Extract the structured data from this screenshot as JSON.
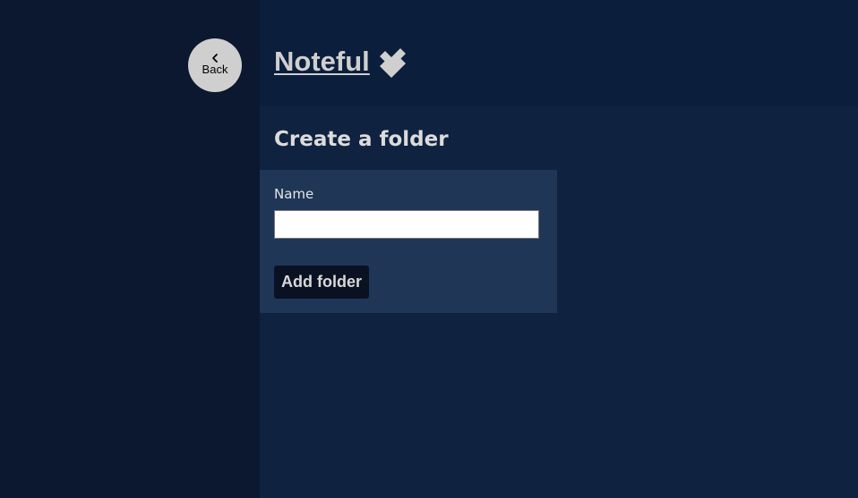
{
  "nav": {
    "back_label": "Back",
    "back_icon": "chevron-left-icon"
  },
  "header": {
    "title": "Noteful",
    "title_icon": "double-check-icon"
  },
  "main": {
    "page_title": "Create a folder",
    "form": {
      "name_label": "Name",
      "name_value": "",
      "name_placeholder": "",
      "submit_label": "Add folder"
    }
  },
  "colors": {
    "sidebar_bg": "#0b1830",
    "header_bg": "#0b1e3b",
    "main_bg": "#0f2240",
    "form_bg": "#1f3656",
    "button_bg": "#0a1123",
    "back_button_bg": "#cfcfcf"
  }
}
